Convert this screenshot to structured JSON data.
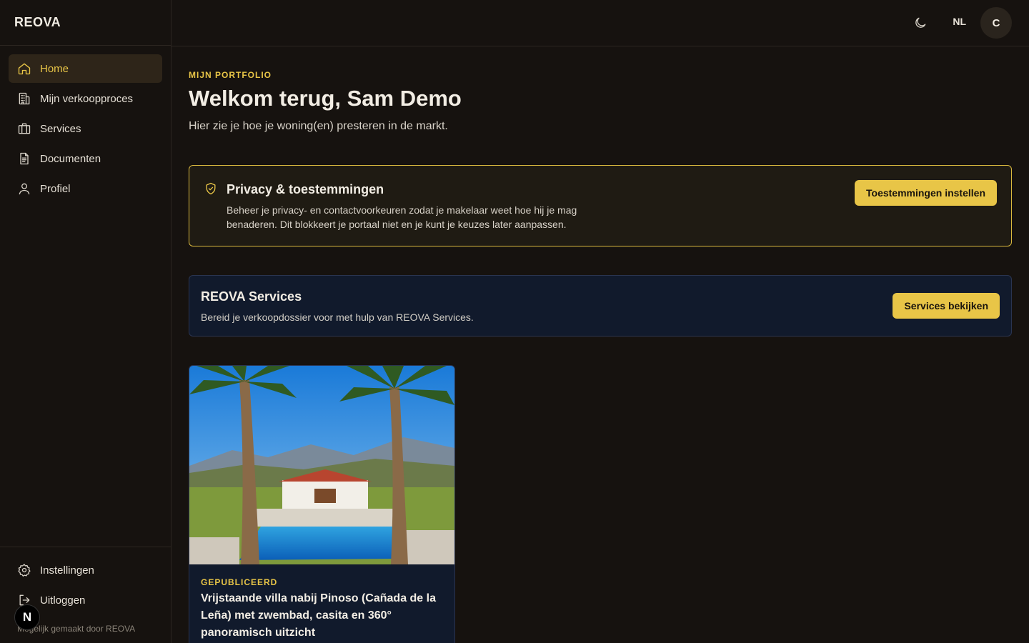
{
  "app": {
    "brand": "REOVA"
  },
  "sidebar": {
    "items": [
      {
        "label": "Home",
        "icon": "home-icon",
        "active": true
      },
      {
        "label": "Mijn verkoopproces",
        "icon": "building-icon",
        "active": false
      },
      {
        "label": "Services",
        "icon": "briefcase-icon",
        "active": false
      },
      {
        "label": "Documenten",
        "icon": "document-icon",
        "active": false
      },
      {
        "label": "Profiel",
        "icon": "user-icon",
        "active": false
      }
    ],
    "bottom": [
      {
        "label": "Instellingen",
        "icon": "gear-icon"
      },
      {
        "label": "Uitloggen",
        "icon": "logout-icon"
      }
    ],
    "footer_text": "Mogelijk gemaakt door REOVA",
    "badge": "N"
  },
  "topbar": {
    "language": "NL",
    "avatar_initial": "C",
    "theme_icon": "moon-icon"
  },
  "main": {
    "eyebrow": "MIJN PORTFOLIO",
    "title": "Welkom terug, Sam Demo",
    "subtitle": "Hier zie je hoe je woning(en) presteren in de markt."
  },
  "privacy": {
    "title": "Privacy & toestemmingen",
    "text": "Beheer je privacy- en contactvoorkeuren zodat je makelaar weet hoe hij je mag benaderen. Dit blokkeert je portaal niet en je kunt je keuzes later aanpassen.",
    "button": "Toestemmingen instellen"
  },
  "services": {
    "title": "REOVA Services",
    "text": "Bereid je verkoopdossier voor met hulp van REOVA Services.",
    "button": "Services bekijken"
  },
  "property": {
    "status": "GEPUBLICEERD",
    "title": "Vrijstaande villa nabij Pinoso (Cañada de la Leña) met zwembad, casita en 360° panoramisch uitzicht"
  },
  "colors": {
    "accent": "#e8c547",
    "background": "#16120f",
    "card_blue": "#111a2c"
  }
}
